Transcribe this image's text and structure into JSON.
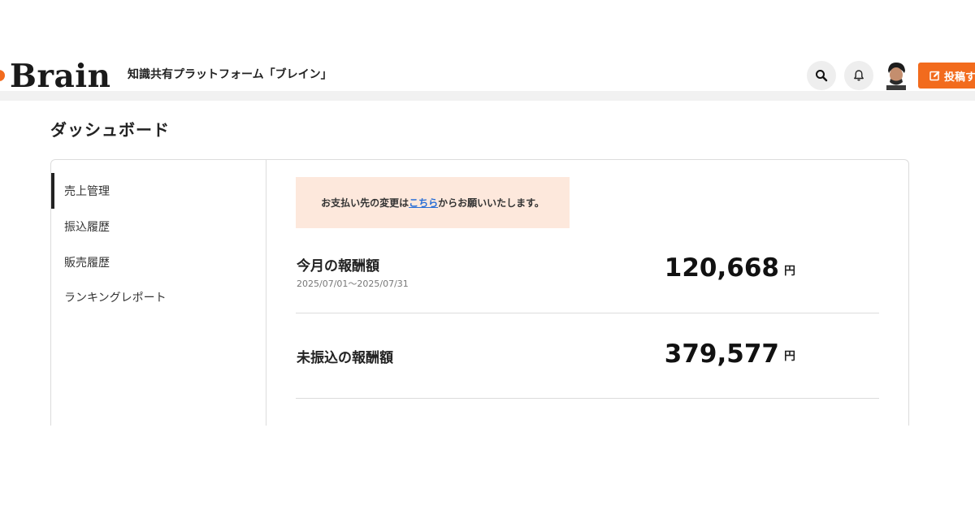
{
  "header": {
    "logo": "Brain",
    "tagline": "知識共有プラットフォーム「ブレイン」",
    "search_icon": "search-icon",
    "bell_icon": "bell-icon",
    "post_label": "投稿す"
  },
  "page_title": "ダッシュボード",
  "sidebar": {
    "items": [
      {
        "label": "売上管理",
        "active": true
      },
      {
        "label": "振込履歴",
        "active": false
      },
      {
        "label": "販売履歴",
        "active": false
      },
      {
        "label": "ランキングレポート",
        "active": false
      }
    ]
  },
  "notice": {
    "before": "お支払い先の変更は",
    "link": "こちら",
    "after": "からお願いいたします。"
  },
  "rows": [
    {
      "label": "今月の報酬額",
      "sub": "2025/07/01〜2025/07/31",
      "amount": "120,668",
      "unit": "円"
    },
    {
      "label": "未振込の報酬額",
      "sub": "",
      "amount": "379,577",
      "unit": "円"
    }
  ],
  "colors": {
    "accent": "#f26b1d",
    "notice_bg": "#fde8dc",
    "link": "#2a6fd6"
  }
}
